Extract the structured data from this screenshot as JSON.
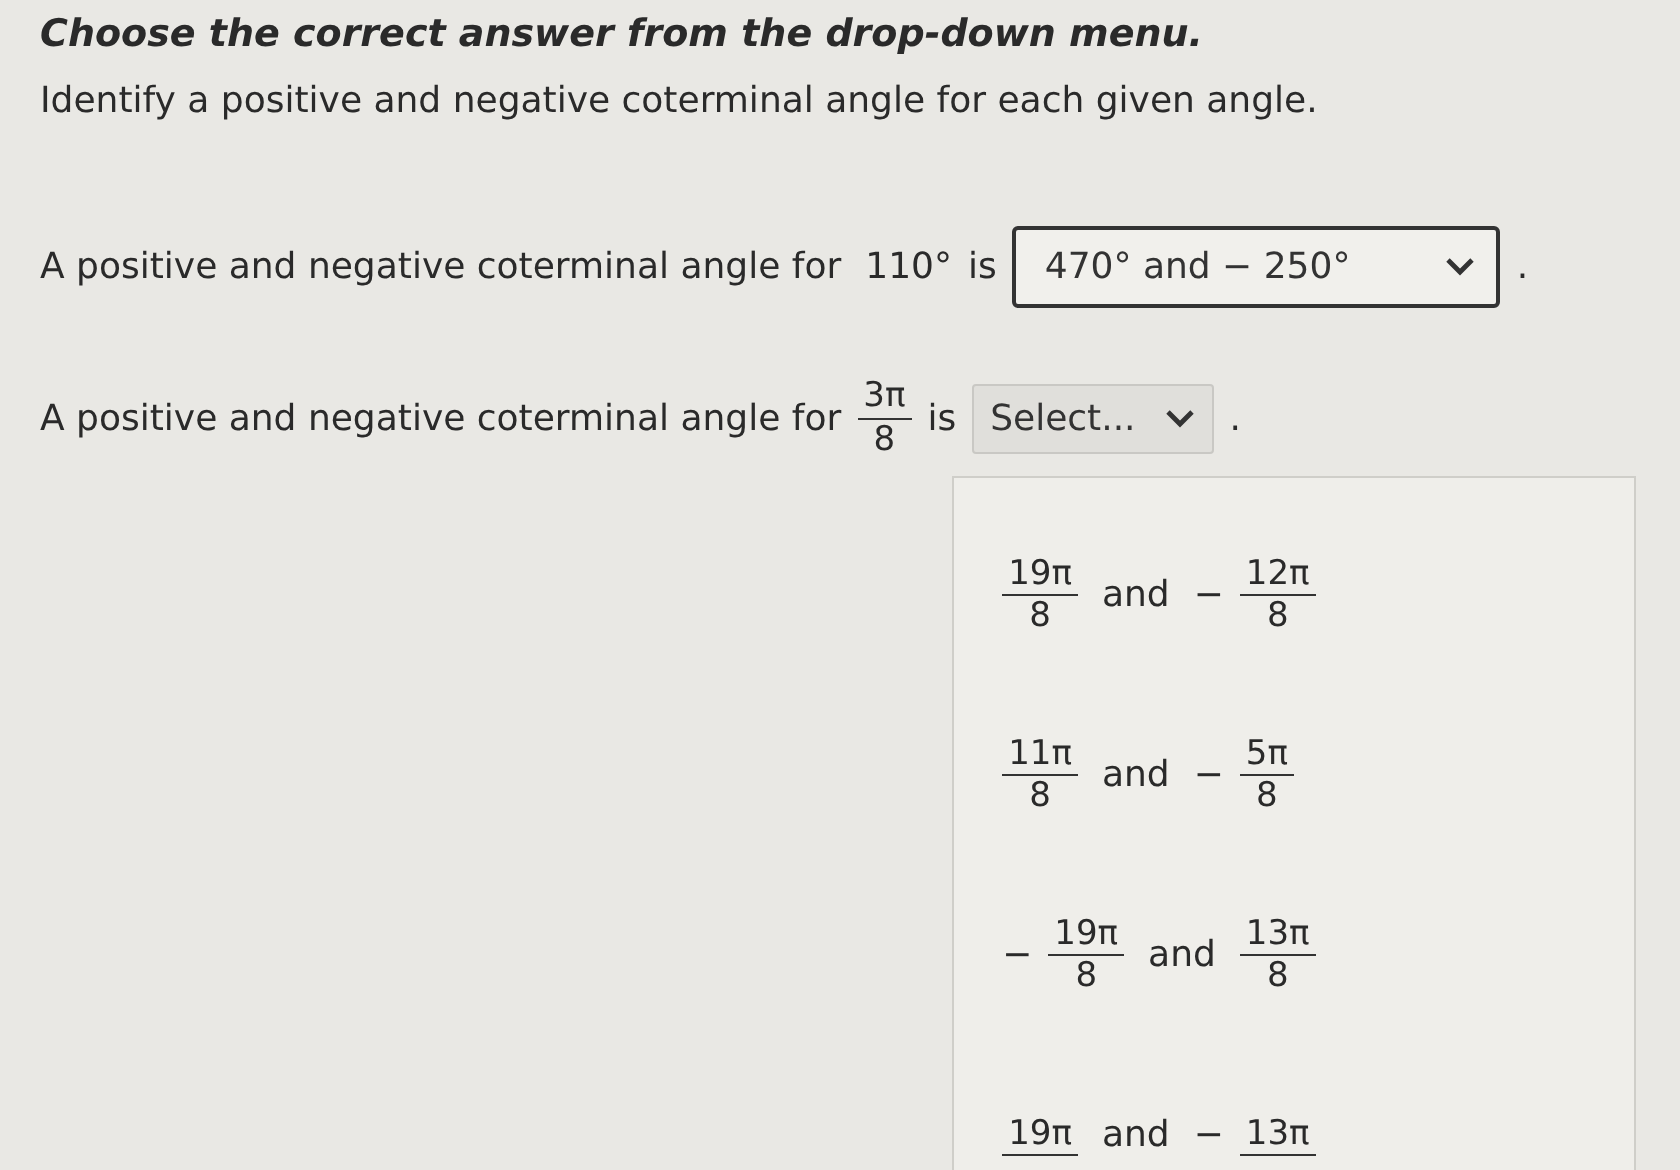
{
  "instruction": "Choose the correct answer from the drop-down menu.",
  "prompt": "Identify a positive and negative coterminal angle for each given angle.",
  "questions": [
    {
      "lead": "A positive and negative coterminal angle for",
      "angle": {
        "kind": "text",
        "text": "110°"
      },
      "verb": "is",
      "dropdown": {
        "value": "470°  and  − 250°",
        "expanded": false
      },
      "end": "."
    },
    {
      "lead": "A positive and negative coterminal angle for",
      "angle": {
        "kind": "fraction",
        "num": "3π",
        "den": "8"
      },
      "verb": "is",
      "dropdown": {
        "value": "Select...",
        "expanded": true,
        "options": [
          {
            "first": {
              "num": "19π",
              "den": "8"
            },
            "joiner": "and",
            "second": {
              "sign": "−",
              "num": "12π",
              "den": "8"
            }
          },
          {
            "first": {
              "num": "11π",
              "den": "8"
            },
            "joiner": "and",
            "second": {
              "sign": "−",
              "num": "5π",
              "den": "8"
            }
          },
          {
            "first": {
              "sign": "−",
              "num": "19π",
              "den": "8"
            },
            "joiner": "and",
            "second": {
              "num": "13π",
              "den": "8"
            }
          },
          {
            "first": {
              "num": "19π"
            },
            "joiner": "and",
            "second": {
              "sign": "−",
              "num": "13π"
            }
          }
        ]
      },
      "end": "."
    }
  ]
}
